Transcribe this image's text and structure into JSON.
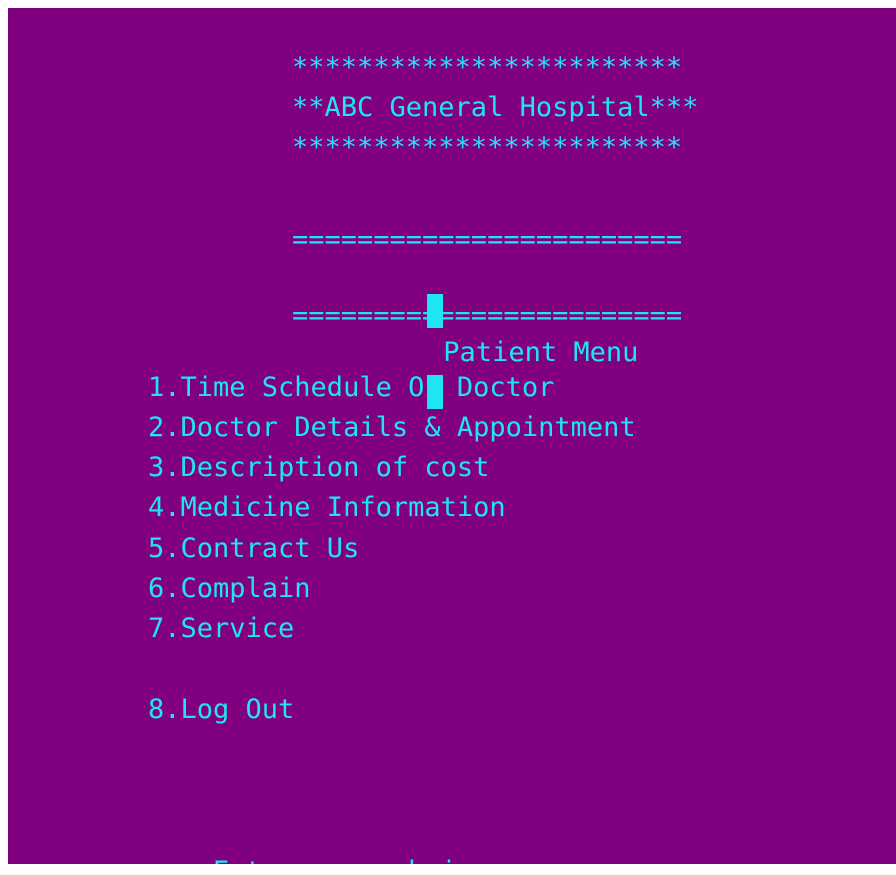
{
  "header": {
    "stars_top": "************************",
    "hospital_name": "**ABC General Hospital***",
    "stars_bottom": "************************"
  },
  "menu_header": {
    "rule_top": "========================",
    "title": "Patient Menu",
    "rule_bottom": "========================"
  },
  "menu": {
    "items": [
      "1.Time Schedule Of Doctor",
      "2.Doctor Details & Appointment",
      "3.Description of cost",
      "4.Medicine Information",
      "5.Contract Us",
      "6.Complain",
      "7.Service"
    ],
    "logout": "8.Log Out"
  },
  "prompt": {
    "text": "Enter your choice:"
  },
  "colors": {
    "background": "#800080",
    "text": "#1ee6f0"
  }
}
